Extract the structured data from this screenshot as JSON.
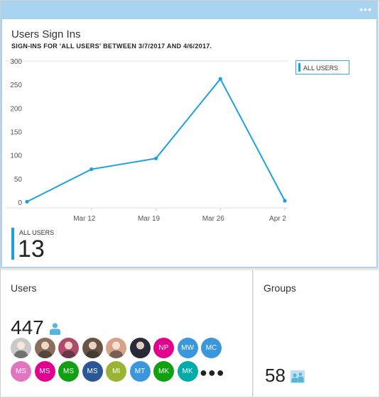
{
  "signins": {
    "title": "Users Sign Ins",
    "subtitle": "SIGN-INS FOR 'ALL USERS' BETWEEN 3/7/2017 AND 4/6/2017.",
    "legend": "ALL USERS",
    "total_label": "ALL USERS",
    "total_value": "13",
    "more_label": "•••"
  },
  "chart_data": {
    "type": "line",
    "x_labels": [
      "Mar 12",
      "Mar 19",
      "Mar 26",
      "Apr 2"
    ],
    "x": [
      "3/5/2017",
      "3/12/2017",
      "3/19/2017",
      "3/26/2017",
      "4/2/2017"
    ],
    "y_ticks": [
      0,
      50,
      100,
      150,
      200,
      250,
      300
    ],
    "ylim": [
      0,
      300
    ],
    "series": [
      {
        "name": "ALL USERS",
        "values": [
          1,
          70,
          93,
          262,
          3
        ]
      }
    ],
    "color": "#1ba1e2"
  },
  "users": {
    "title": "Users",
    "count": "447",
    "icon": "person-icon",
    "avatars": [
      {
        "type": "photo",
        "color": "#c9c9c9",
        "initials": ""
      },
      {
        "type": "photo",
        "color": "#8a6d5a",
        "initials": ""
      },
      {
        "type": "photo",
        "color": "#b04a6a",
        "initials": ""
      },
      {
        "type": "photo",
        "color": "#6b5344",
        "initials": ""
      },
      {
        "type": "photo",
        "color": "#d7a28a",
        "initials": ""
      },
      {
        "type": "photo",
        "color": "#2a2a3d",
        "initials": ""
      },
      {
        "type": "initials",
        "color": "#e3008c",
        "initials": "NP"
      },
      {
        "type": "initials",
        "color": "#3a96dd",
        "initials": "MW"
      },
      {
        "type": "initials",
        "color": "#3a96dd",
        "initials": "MC"
      },
      {
        "type": "initials",
        "color": "#e374c0",
        "initials": "MS"
      },
      {
        "type": "initials",
        "color": "#e3008c",
        "initials": "MS"
      },
      {
        "type": "initials",
        "color": "#10a010",
        "initials": "MS"
      },
      {
        "type": "initials",
        "color": "#2b5797",
        "initials": "MS"
      },
      {
        "type": "initials",
        "color": "#99b433",
        "initials": "MI"
      },
      {
        "type": "initials",
        "color": "#3a96dd",
        "initials": "MT"
      },
      {
        "type": "initials",
        "color": "#10a010",
        "initials": "MK"
      },
      {
        "type": "initials",
        "color": "#00aba9",
        "initials": "MK"
      }
    ],
    "more": "●●●"
  },
  "groups": {
    "title": "Groups",
    "count": "58",
    "icon": "groups-icon"
  }
}
